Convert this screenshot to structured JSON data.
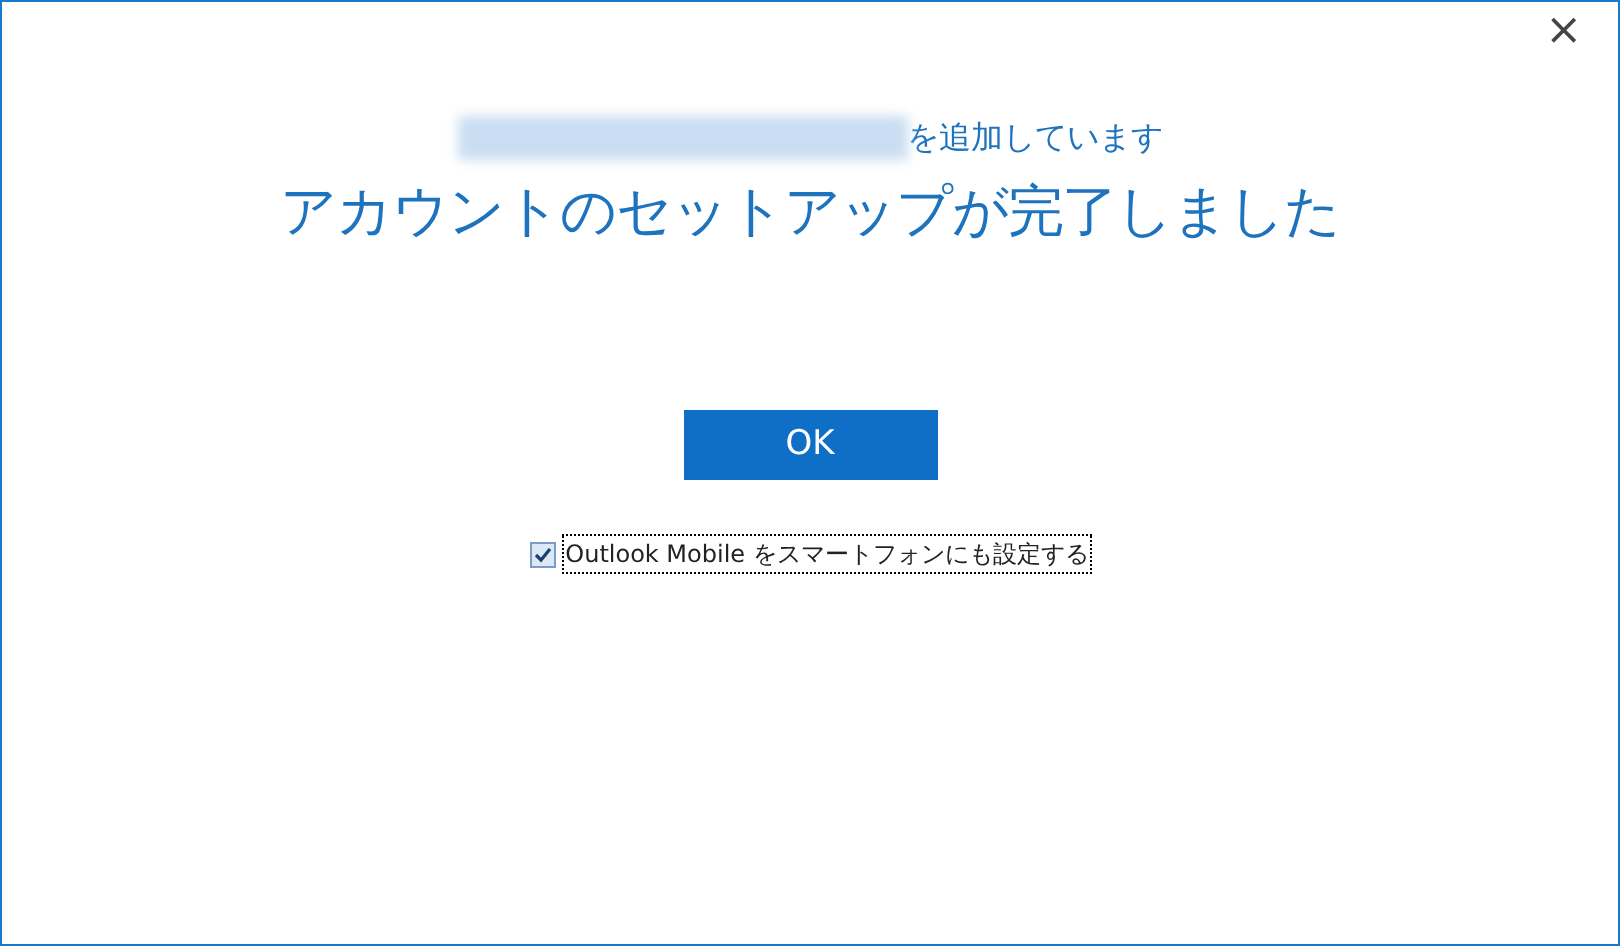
{
  "window": {
    "close_glyph": "×"
  },
  "adding_suffix": "を追加しています",
  "heading": "アカウントのセットアップが完了しました",
  "ok_button": "OK",
  "checkbox": {
    "label": "Outlook Mobile をスマートフォンにも設定する",
    "checked": true,
    "focused": true
  }
}
